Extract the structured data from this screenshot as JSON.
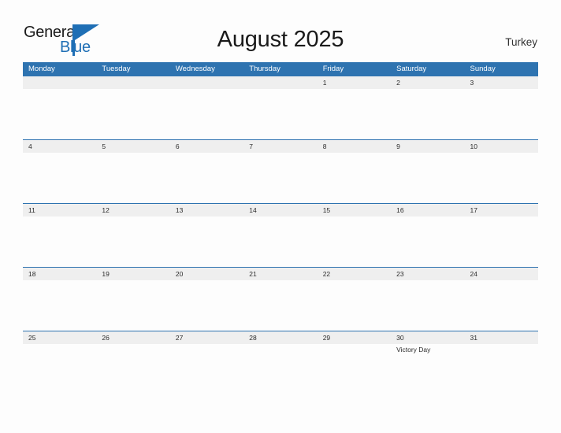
{
  "brand": {
    "name_part1": "General",
    "name_part2": "Blue",
    "flag_icon": "flag-triangle-icon",
    "accent_color": "#1f6fb5"
  },
  "header": {
    "title": "August 2025",
    "country": "Turkey"
  },
  "calendar": {
    "header_color": "#2e73b0",
    "band_color": "#efefef",
    "weekdays": [
      "Monday",
      "Tuesday",
      "Wednesday",
      "Thursday",
      "Friday",
      "Saturday",
      "Sunday"
    ],
    "weeks": [
      {
        "days": [
          {
            "num": "",
            "event": ""
          },
          {
            "num": "",
            "event": ""
          },
          {
            "num": "",
            "event": ""
          },
          {
            "num": "",
            "event": ""
          },
          {
            "num": "1",
            "event": ""
          },
          {
            "num": "2",
            "event": ""
          },
          {
            "num": "3",
            "event": ""
          }
        ]
      },
      {
        "days": [
          {
            "num": "4",
            "event": ""
          },
          {
            "num": "5",
            "event": ""
          },
          {
            "num": "6",
            "event": ""
          },
          {
            "num": "7",
            "event": ""
          },
          {
            "num": "8",
            "event": ""
          },
          {
            "num": "9",
            "event": ""
          },
          {
            "num": "10",
            "event": ""
          }
        ]
      },
      {
        "days": [
          {
            "num": "11",
            "event": ""
          },
          {
            "num": "12",
            "event": ""
          },
          {
            "num": "13",
            "event": ""
          },
          {
            "num": "14",
            "event": ""
          },
          {
            "num": "15",
            "event": ""
          },
          {
            "num": "16",
            "event": ""
          },
          {
            "num": "17",
            "event": ""
          }
        ]
      },
      {
        "days": [
          {
            "num": "18",
            "event": ""
          },
          {
            "num": "19",
            "event": ""
          },
          {
            "num": "20",
            "event": ""
          },
          {
            "num": "21",
            "event": ""
          },
          {
            "num": "22",
            "event": ""
          },
          {
            "num": "23",
            "event": ""
          },
          {
            "num": "24",
            "event": ""
          }
        ]
      },
      {
        "days": [
          {
            "num": "25",
            "event": ""
          },
          {
            "num": "26",
            "event": ""
          },
          {
            "num": "27",
            "event": ""
          },
          {
            "num": "28",
            "event": ""
          },
          {
            "num": "29",
            "event": ""
          },
          {
            "num": "30",
            "event": "Victory Day"
          },
          {
            "num": "31",
            "event": ""
          }
        ]
      }
    ]
  }
}
